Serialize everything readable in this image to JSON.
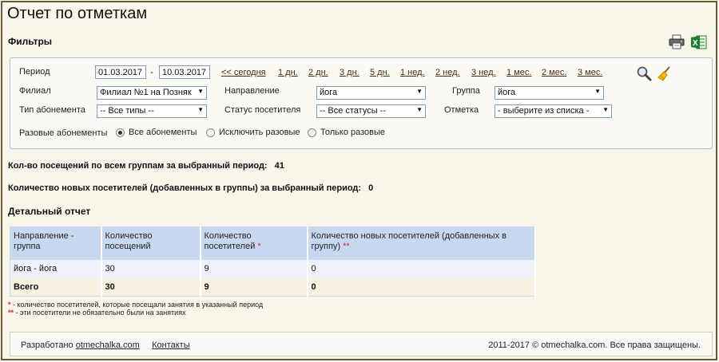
{
  "header": {
    "title": "Отчет по отметкам",
    "filters_title": "Фильтры"
  },
  "icons": {
    "print": "printer-icon",
    "excel": "excel-icon",
    "search": "search-icon",
    "clear": "broom-icon"
  },
  "filters": {
    "period_label": "Период",
    "date_from": "01.03.2017",
    "date_to": "10.03.2017",
    "dash": "-",
    "quick_links": [
      "<< сегодня",
      "1 дн.",
      "2 дн.",
      "3 дн.",
      "5 дн.",
      "1 нед.",
      "2 нед.",
      "3 нед.",
      "1 мес.",
      "2 мес.",
      "3 мес."
    ],
    "branch_label": "Филиал",
    "branch_value": "Филиал №1 на Позняк",
    "direction_label": "Направление",
    "direction_value": "йога",
    "group_label": "Группа",
    "group_value": "йога",
    "subscription_label": "Тип абонемента",
    "subscription_value": "-- Все типы --",
    "visitor_status_label": "Статус посетителя",
    "visitor_status_value": "-- Все статусы --",
    "mark_label": "Отметка",
    "mark_value": "- выберите из списка -",
    "onetime_label": "Разовые абонементы",
    "radio_options": [
      "Все абонементы",
      "Исключить разовые",
      "Только разовые"
    ],
    "radio_selected": 0
  },
  "stats": {
    "visits_label": "Кол-во посещений по всем группам за выбранный период:",
    "visits_value": "41",
    "new_label": "Количество новых посетителей (добавленных в группы) за выбранный период:",
    "new_value": "0"
  },
  "detail": {
    "title": "Детальный отчет",
    "columns": [
      {
        "text": "Направление - группа",
        "mark": ""
      },
      {
        "text": "Количество посещений",
        "mark": ""
      },
      {
        "text": "Количество посетителей",
        "mark": "*"
      },
      {
        "text": "Количество новых посетителей (добавленных в группу)",
        "mark": "**"
      }
    ],
    "rows": [
      [
        "йога - йога",
        "30",
        "9",
        "0"
      ]
    ],
    "total": [
      "Всего",
      "30",
      "9",
      "0"
    ]
  },
  "notes": [
    {
      "mark": "*",
      "text": " - количество посетителей, которые посещали занятия в указанный период"
    },
    {
      "mark": "**",
      "text": " - эти посетители не обязательно были на занятиях"
    }
  ],
  "footer": {
    "developed_label": "Разработано",
    "developer_link": "otmechalka.com",
    "contacts_link": "Контакты",
    "copyright": "2011-2017 © otmechalka.com. Все права защищены."
  },
  "colors": {
    "frame_border": "#6e5a2c",
    "background": "#f8f5ea",
    "table_header": "#c6d9f1",
    "link": "#4a2e0c",
    "required_mark": "#e0201b"
  }
}
